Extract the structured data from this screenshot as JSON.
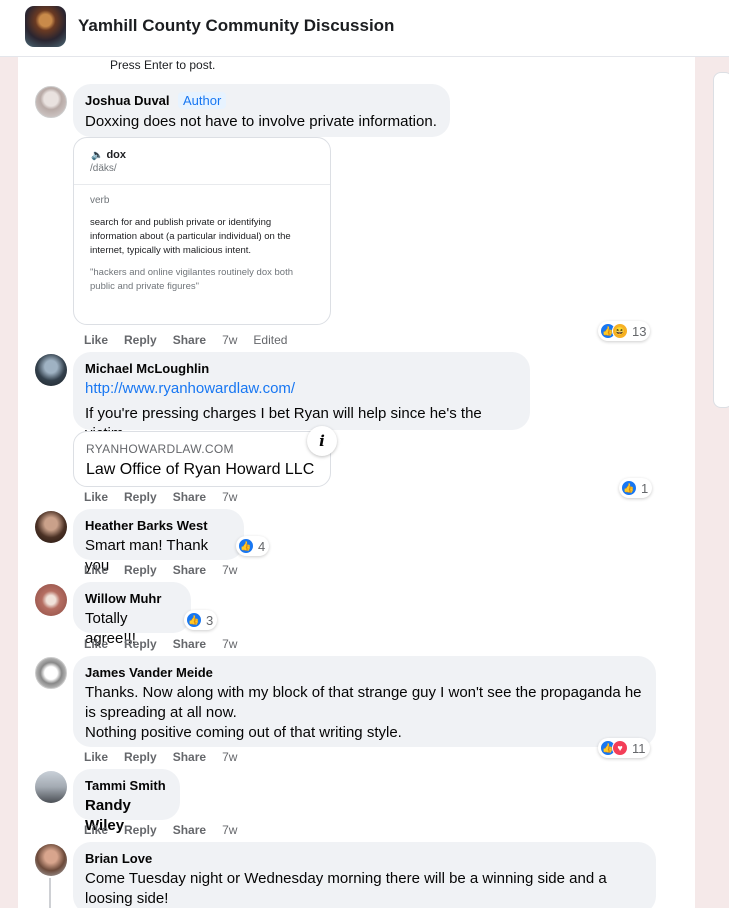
{
  "group": {
    "title": "Yamhill County Community Discussion"
  },
  "composer": {
    "hint": "Press Enter to post."
  },
  "comments": [
    {
      "author": "Joshua Duval",
      "badge": "Author",
      "text": "Doxxing does not have to involve private information.",
      "attachment": {
        "word": "dox",
        "pronunciation": "/däks/",
        "part_of_speech": "verb",
        "definition": "search for and publish private or identifying information about (a particular individual) on the internet, typically with malicious intent.",
        "example": "\"hackers and online vigilantes routinely dox both public and private figures\""
      },
      "actions": {
        "like": "Like",
        "reply": "Reply",
        "share": "Share",
        "time": "7w",
        "edited": "Edited"
      },
      "reactions": {
        "icons": [
          "like",
          "haha"
        ],
        "count": "13"
      }
    },
    {
      "author": "Michael McLoughlin",
      "link": "http://www.ryanhowardlaw.com/",
      "text": "If you're pressing charges I bet Ryan will help since he's the victim",
      "link_preview": {
        "domain": "RYANHOWARDLAW.COM",
        "title": "Law Office of Ryan Howard LLC",
        "info_icon": "i"
      },
      "actions": {
        "like": "Like",
        "reply": "Reply",
        "share": "Share",
        "time": "7w"
      },
      "reactions": {
        "icons": [
          "like"
        ],
        "count": "1"
      }
    },
    {
      "author": "Heather Barks West",
      "text": "Smart man! Thank you",
      "actions": {
        "like": "Like",
        "reply": "Reply",
        "share": "Share",
        "time": "7w"
      },
      "reactions": {
        "icons": [
          "like"
        ],
        "count": "4"
      }
    },
    {
      "author": "Willow Muhr",
      "text": "Totally agree!!!",
      "actions": {
        "like": "Like",
        "reply": "Reply",
        "share": "Share",
        "time": "7w"
      },
      "reactions": {
        "icons": [
          "like"
        ],
        "count": "3"
      }
    },
    {
      "author": "James Vander Meide",
      "text_lines": [
        "Thanks. Now along with my block of that strange guy I won't see the propaganda he",
        "is spreading at all now.",
        "Nothing positive coming out of that writing style."
      ],
      "actions": {
        "like": "Like",
        "reply": "Reply",
        "share": "Share",
        "time": "7w"
      },
      "reactions": {
        "icons": [
          "like",
          "love"
        ],
        "count": "11"
      }
    },
    {
      "author": "Tammi Smith",
      "mention": "Randy Wiley",
      "actions": {
        "like": "Like",
        "reply": "Reply",
        "share": "Share",
        "time": "7w"
      }
    },
    {
      "author": "Brian Love",
      "text_lines": [
        "Come Tuesday night or Wednesday morning there will be a winning side and a",
        "loosing side!"
      ]
    }
  ],
  "colors": {
    "accent": "#1877f2",
    "bubble": "#f0f2f5",
    "like": "#1877f2",
    "haha": "#f7b125",
    "love": "#f33e58"
  }
}
